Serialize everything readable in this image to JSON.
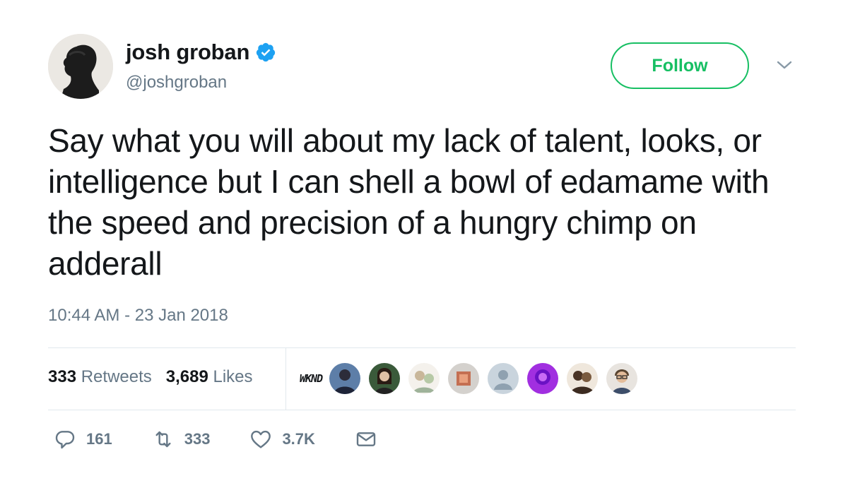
{
  "header": {
    "display_name": "josh groban",
    "handle": "@joshgroban",
    "verified_icon": "verified-badge-icon",
    "follow_label": "Follow",
    "accent_color": "#17bf63",
    "verified_color": "#1da1f2"
  },
  "tweet": {
    "text": "Say what you will about my lack of talent, looks, or intelligence but I can shell a bowl of edamame with the speed and precision of a hungry chimp on adderall",
    "timestamp": "10:44 AM - 23 Jan 2018"
  },
  "stats": {
    "retweets_count": "333",
    "retweets_label": "Retweets",
    "likes_count": "3,689",
    "likes_label": "Likes"
  },
  "likers": {
    "first_label": "WKND"
  },
  "actions": {
    "reply_count": "161",
    "retweet_count": "333",
    "like_count": "3.7K"
  }
}
